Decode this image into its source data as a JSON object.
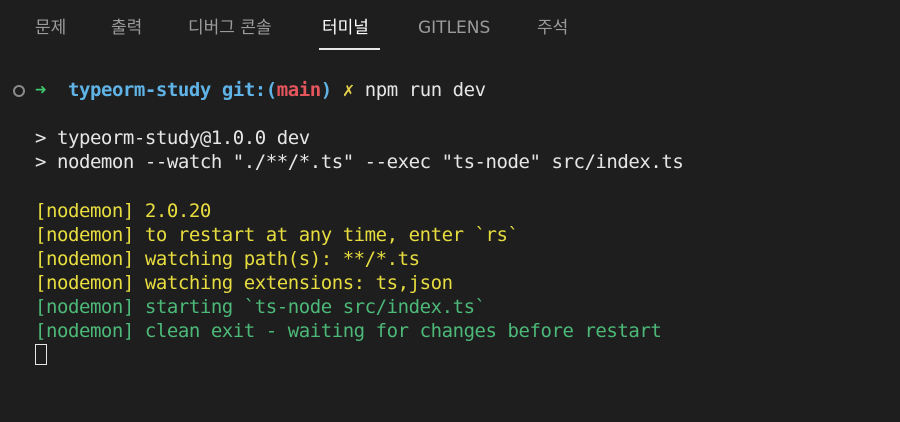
{
  "panel": {
    "tabs": [
      {
        "label": "문제"
      },
      {
        "label": "출력"
      },
      {
        "label": "디버그 콘솔"
      },
      {
        "label": "터미널",
        "active": true
      },
      {
        "label": "GITLENS"
      },
      {
        "label": "주석"
      }
    ]
  },
  "terminal": {
    "prompt": {
      "arrow": "➜",
      "dir": "typeorm-study",
      "git_prefix": "git:(",
      "branch": "main",
      "git_suffix": ")",
      "dirty_mark": "✗",
      "command": "npm run dev"
    },
    "script_lines": [
      "> typeorm-study@1.0.0 dev",
      "> nodemon --watch \"./**/*.ts\" --exec \"ts-node\" src/index.ts"
    ],
    "nodemon_lines": [
      {
        "text": "[nodemon] 2.0.20",
        "color": "yellow"
      },
      {
        "text": "[nodemon] to restart at any time, enter `rs`",
        "color": "yellow"
      },
      {
        "text": "[nodemon] watching path(s): **/*.ts",
        "color": "yellow"
      },
      {
        "text": "[nodemon] watching extensions: ts,json",
        "color": "yellow"
      },
      {
        "text": "[nodemon] starting `ts-node src/index.ts`",
        "color": "green"
      },
      {
        "text": "[nodemon] clean exit - waiting for changes before restart",
        "color": "green"
      }
    ]
  }
}
